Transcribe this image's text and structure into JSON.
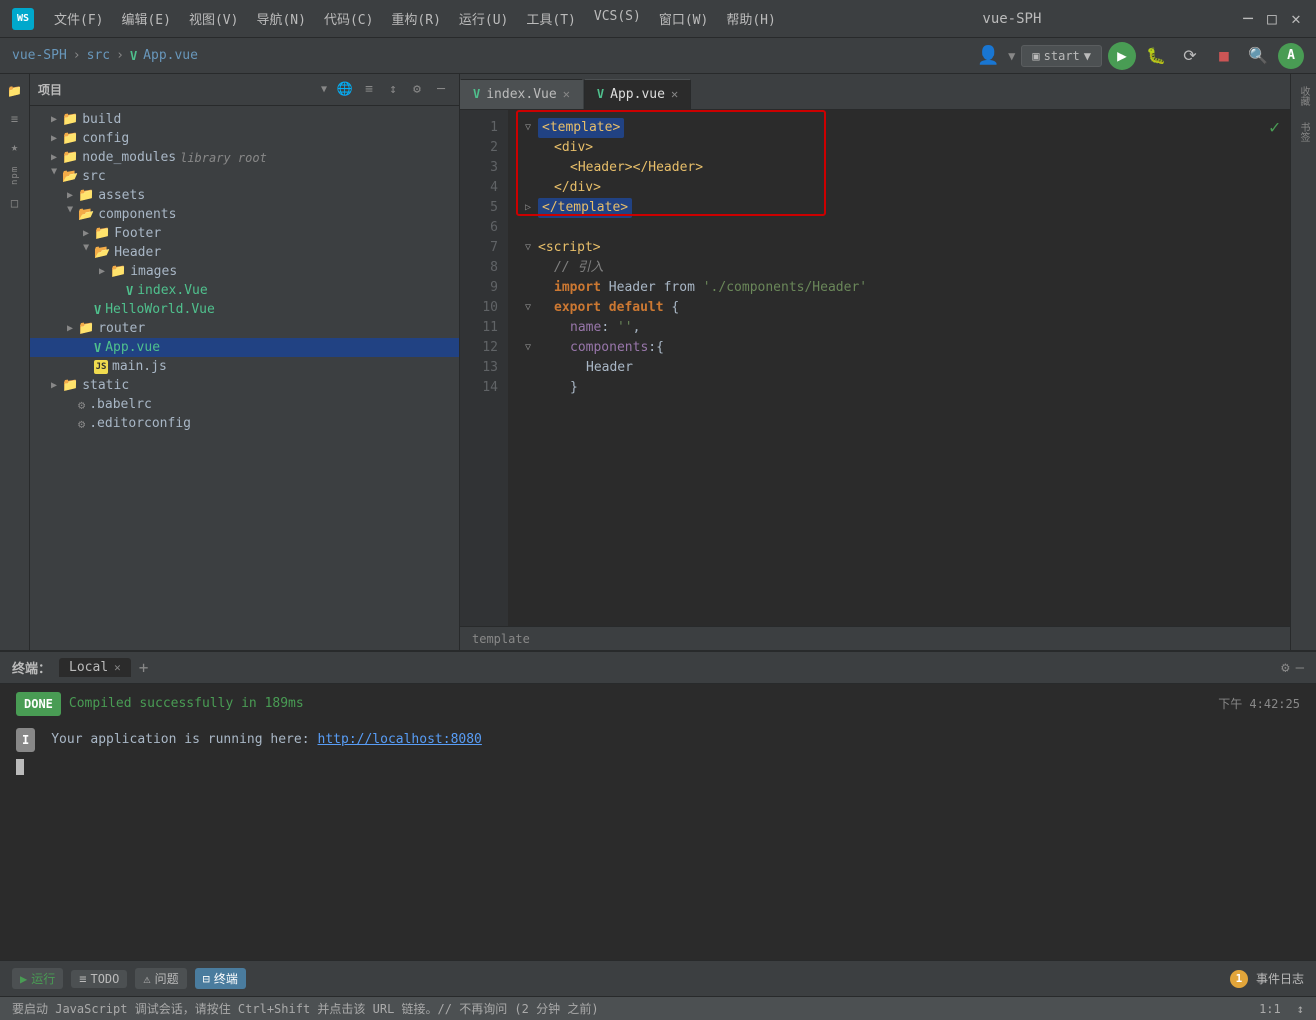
{
  "titlebar": {
    "logo": "WS",
    "menus": [
      "文件(F)",
      "编辑(E)",
      "视图(V)",
      "导航(N)",
      "代码(C)",
      "重构(R)",
      "运行(U)",
      "工具(T)",
      "VCS(S)",
      "窗口(W)",
      "帮助(H)"
    ],
    "title": "vue-SPH",
    "controls": [
      "─",
      "□",
      "✕"
    ]
  },
  "navbar": {
    "breadcrumb": [
      "vue-SPH",
      "src",
      "App.vue"
    ],
    "run_btn": "start",
    "avatar_initial": "A"
  },
  "file_panel": {
    "title": "项目",
    "items": [
      {
        "id": "build",
        "label": "build",
        "type": "folder",
        "level": 1,
        "collapsed": true
      },
      {
        "id": "config",
        "label": "config",
        "type": "folder",
        "level": 1,
        "collapsed": true
      },
      {
        "id": "node_modules",
        "label": "node_modules",
        "type": "folder",
        "level": 1,
        "collapsed": true,
        "tag": "library root"
      },
      {
        "id": "src",
        "label": "src",
        "type": "folder",
        "level": 1,
        "collapsed": false
      },
      {
        "id": "assets",
        "label": "assets",
        "type": "folder",
        "level": 2,
        "collapsed": true
      },
      {
        "id": "components",
        "label": "components",
        "type": "folder",
        "level": 2,
        "collapsed": false
      },
      {
        "id": "Footer",
        "label": "Footer",
        "type": "folder",
        "level": 3,
        "collapsed": true
      },
      {
        "id": "Header",
        "label": "Header",
        "type": "folder",
        "level": 3,
        "collapsed": false
      },
      {
        "id": "images",
        "label": "images",
        "type": "folder",
        "level": 4,
        "collapsed": true
      },
      {
        "id": "index.Vue",
        "label": "index.Vue",
        "type": "vue",
        "level": 4
      },
      {
        "id": "HelloWorld.Vue",
        "label": "HelloWorld.Vue",
        "type": "vue",
        "level": 3
      },
      {
        "id": "router",
        "label": "router",
        "type": "folder",
        "level": 2,
        "collapsed": true
      },
      {
        "id": "App.vue",
        "label": "App.vue",
        "type": "vue",
        "level": 2,
        "selected": true
      },
      {
        "id": "main.js",
        "label": "main.js",
        "type": "js",
        "level": 2
      },
      {
        "id": "static",
        "label": "static",
        "type": "folder",
        "level": 1,
        "collapsed": true
      },
      {
        "id": ".babelrc",
        "label": ".babelrc",
        "type": "file",
        "level": 1
      },
      {
        "id": "editorconfig",
        "label": ".editorconfig",
        "type": "file",
        "level": 1
      }
    ]
  },
  "editor": {
    "tabs": [
      {
        "label": "index.Vue",
        "active": false,
        "id": "index-vue"
      },
      {
        "label": "App.vue",
        "active": true,
        "id": "app-vue"
      }
    ],
    "lines": [
      {
        "num": 1,
        "code": "<template>",
        "type": "template-open"
      },
      {
        "num": 2,
        "code": "  <div>",
        "type": "normal"
      },
      {
        "num": 3,
        "code": "    <Header></Header>",
        "type": "normal"
      },
      {
        "num": 4,
        "code": "  </div>",
        "type": "normal"
      },
      {
        "num": 5,
        "code": "</template>",
        "type": "template-close"
      },
      {
        "num": 6,
        "code": "",
        "type": "normal"
      },
      {
        "num": 7,
        "code": "<script>",
        "type": "script-open"
      },
      {
        "num": 8,
        "code": "  // 引入",
        "type": "comment"
      },
      {
        "num": 9,
        "code": "  import Header from './components/Header'",
        "type": "import"
      },
      {
        "num": 10,
        "code": "  export default {",
        "type": "export"
      },
      {
        "num": 11,
        "code": "    name: '',",
        "type": "prop"
      },
      {
        "num": 12,
        "code": "    components:{",
        "type": "components"
      },
      {
        "num": 13,
        "code": "      Header",
        "type": "header-ref"
      },
      {
        "num": 14,
        "code": "    }",
        "type": "close-brace"
      }
    ],
    "breadcrumb": "template",
    "checkmark": "✓"
  },
  "terminal": {
    "title": "终端：",
    "tab_label": "Local",
    "done_badge": "DONE",
    "success_message": "Compiled successfully in 189ms",
    "timestamp": "下午 4:42:25",
    "i_badge": "I",
    "running_text": "Your application is running here:",
    "url": "http://localhost:8080",
    "add_icon": "+",
    "gear_icon": "⚙",
    "close_icon": "—"
  },
  "status_bar": {
    "run_label": "运行",
    "todo_label": "TODO",
    "problems_label": "问题",
    "terminal_label": "终端",
    "event_count": "1",
    "event_log_label": "事件日志"
  },
  "info_bar": {
    "message": "要启动 JavaScript 调试会话，请按住 Ctrl+Shift 并点击该 URL 链接。// 不再询问 (2 分钟 之前)",
    "position": "1:1",
    "separator": "↕"
  }
}
